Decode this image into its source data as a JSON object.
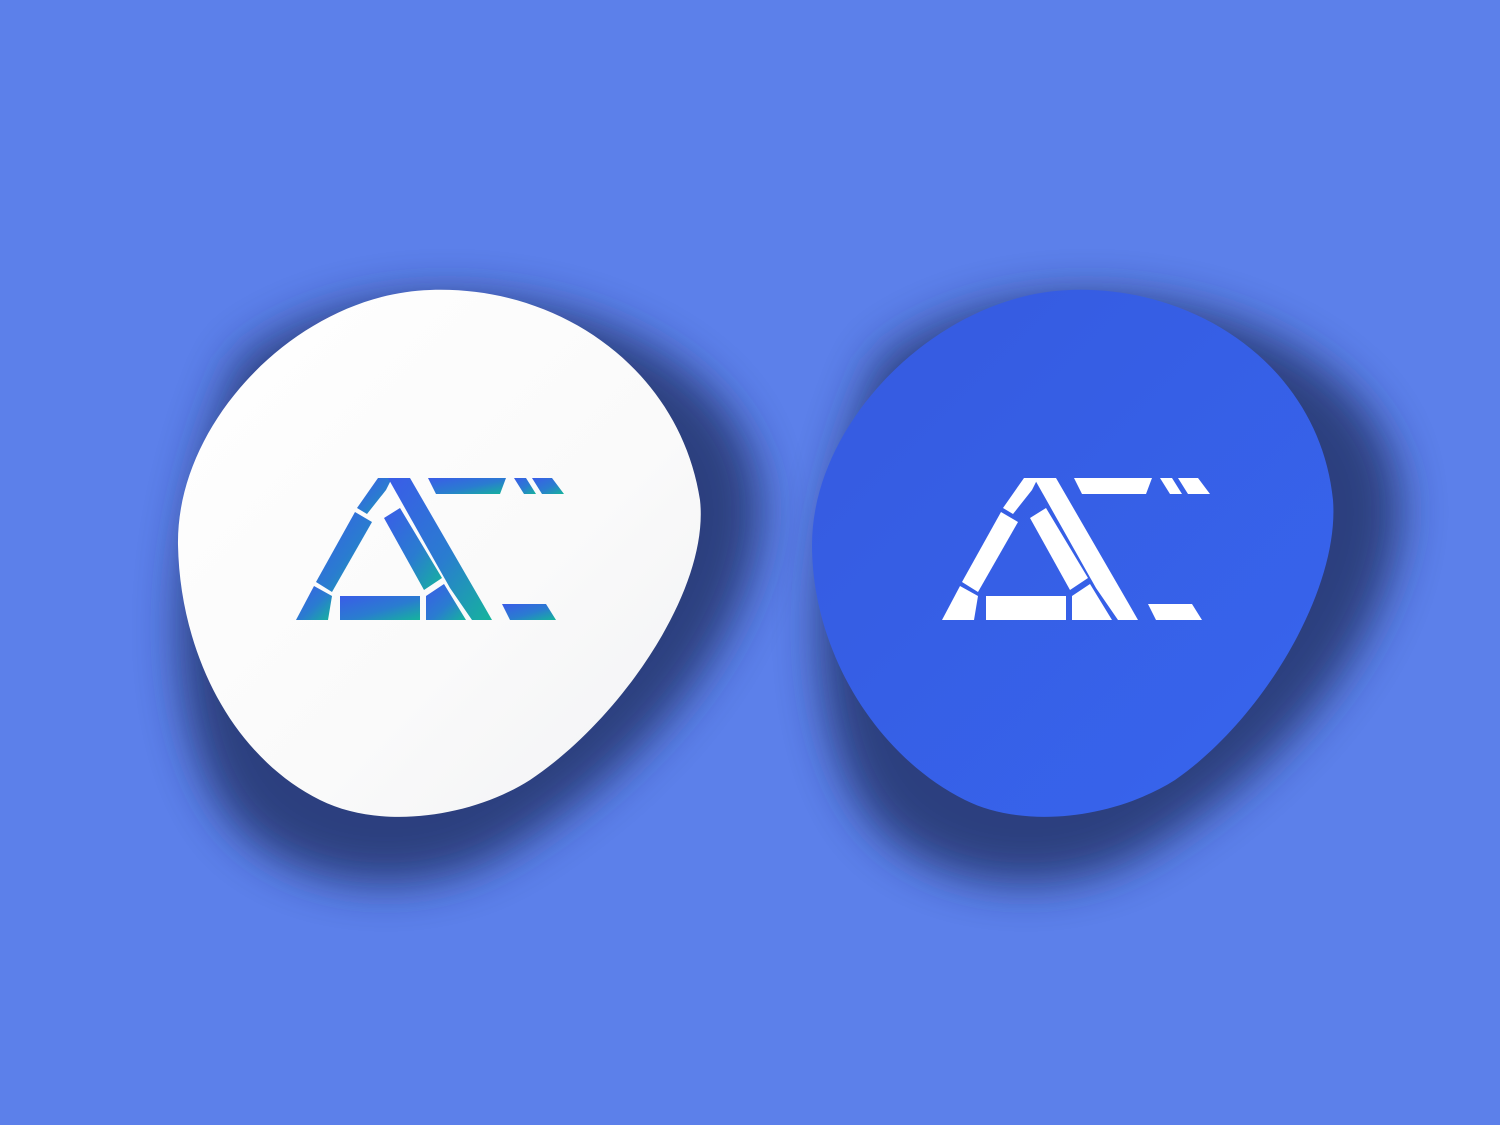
{
  "scene": {
    "background_color": "#5c80ea",
    "shadow_color": "#1e2b5c"
  },
  "stickers": [
    {
      "name": "white-sticker",
      "fill_color": "#f9f9f9",
      "logo_style": "gradient",
      "logo_gradient": [
        "#3a5ce8",
        "#2a7cd0",
        "#15b49c"
      ]
    },
    {
      "name": "blue-sticker",
      "fill_color": "#3a63e6",
      "logo_style": "solid",
      "logo_color": "#ffffff"
    }
  ],
  "logo": {
    "icon": "ac-monogram-logo"
  }
}
